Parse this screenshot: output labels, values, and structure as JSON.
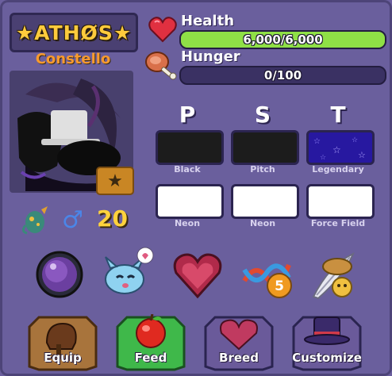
{
  "pet": {
    "name": "★ATHØS★",
    "species": "Constello",
    "age": "20",
    "gender_symbol": "♂"
  },
  "stats": {
    "health_label": "Health",
    "health_value": "6,000/6,000",
    "health_fraction": 1.0,
    "hunger_label": "Hunger",
    "hunger_value": "0/100",
    "hunger_fraction": 0.0,
    "health_color": "#8fe046"
  },
  "traits": {
    "headers": [
      "P",
      "S",
      "T"
    ],
    "row1": [
      {
        "label": "Black",
        "color": "#1c1c1c"
      },
      {
        "label": "Pitch",
        "color": "#1c1c1c"
      },
      {
        "label": "Legendary",
        "color": "#2a1aa8"
      }
    ],
    "row2": [
      {
        "label": "Neon",
        "color": "#ffffff"
      },
      {
        "label": "Neon",
        "color": "#ffffff"
      },
      {
        "label": "Force Field",
        "color": "#ffffff"
      }
    ]
  },
  "icons": [
    "orb-icon",
    "baby-dragon-icon",
    "heart-gem-icon",
    "dna-5-icon",
    "hat-feather-icon"
  ],
  "dna_badge": "5",
  "actions": {
    "equip": "Equip",
    "feed": "Feed",
    "breed": "Breed",
    "customize": "Customize"
  }
}
